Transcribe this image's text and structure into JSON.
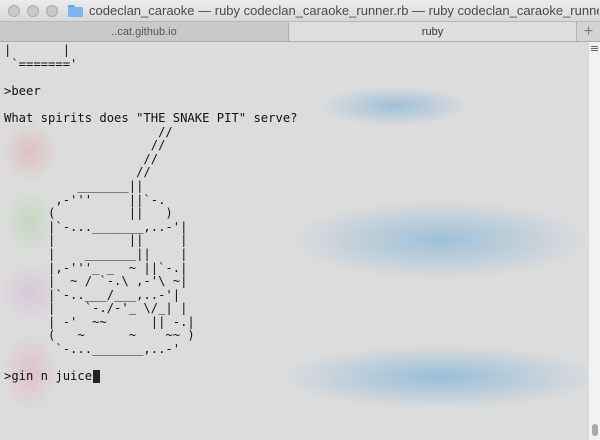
{
  "window": {
    "title": "codeclan_caraoke — ruby codeclan_caraoke_runner.rb — ruby codeclan_caraoke_runner.rb..."
  },
  "tabs": [
    {
      "label": "..cat.github.io",
      "active": false
    },
    {
      "label": "ruby",
      "active": true
    }
  ],
  "new_tab_label": "+",
  "terminal": {
    "art_top": "|       |\n `======='",
    "command": ">beer",
    "question": "What spirits does \"THE SNAKE PIT\" serve?",
    "glass_art": "                     //\n                    //\n                   //\n                  //\n          _______||\n       ,-'''     ||`-.\n      (          ||   )\n      |`-..._______,..-'|\n      |          ||     |\n      |    _______||    |\n      |,-'''_ _  ~ ||`-.|\n      |  ~ / `-.\\ ,-'\\ ~|\n      |`-..___/___,..-'|\n      |    `-./-'_ \\/_| |\n      | -'  ~~      || -.|\n      (   ~      ~    ~~ )\n       `-..._______,..-'",
    "input_line": ">gin n juice"
  },
  "colors": {
    "terminal_bg": "#dcdcdc",
    "text": "#111111",
    "blur_blue": "#6caad7"
  }
}
